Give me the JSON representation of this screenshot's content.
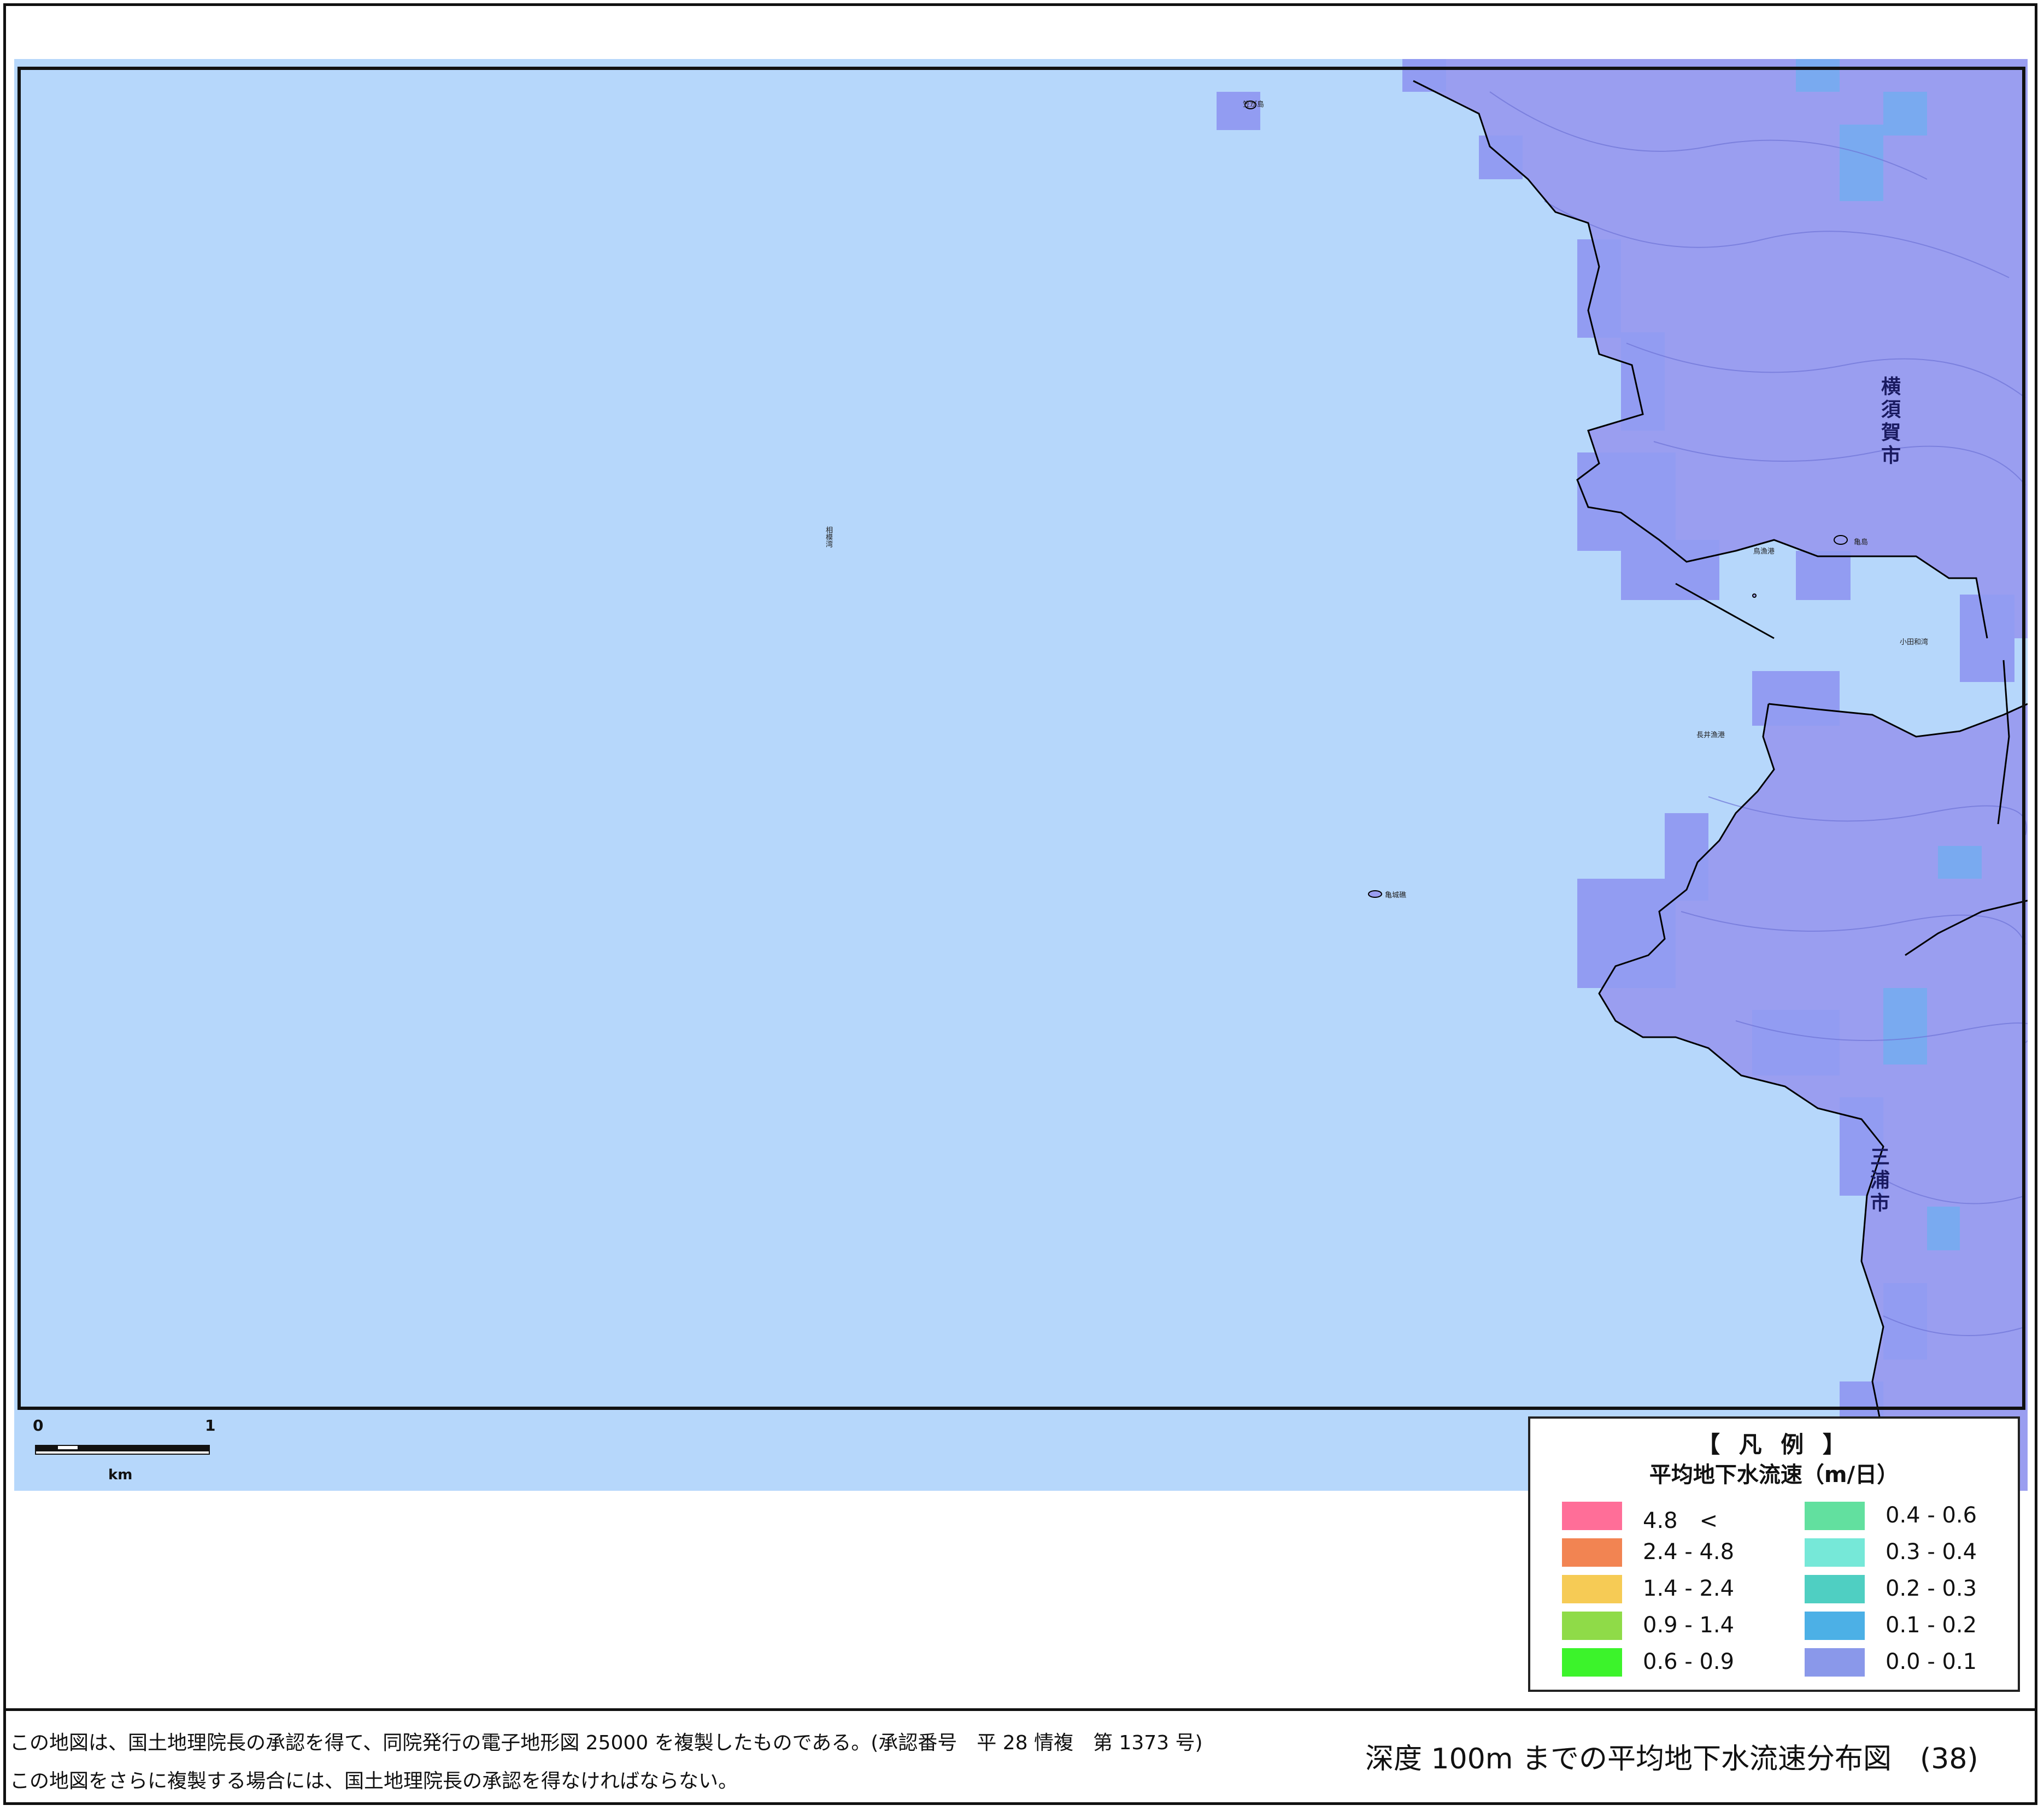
{
  "map": {
    "sea_color": "#b6d7fb",
    "land_color": "#9a9ef0",
    "grid_color": "#8c94ee",
    "water_cell_color": "#79aaf0",
    "coastline_color": "#000000",
    "labels": {
      "island_top": "笠が島",
      "bay": "相模湾",
      "port_1": "鳥漁港",
      "islet": "亀島",
      "bay_east": "小田和湾",
      "port_2": "長井漁港",
      "islet_2": "亀城礁",
      "city_1": "横須賀市",
      "city_2": "三浦市"
    }
  },
  "scale_bar": {
    "start": "0",
    "end": "1",
    "unit": "km"
  },
  "legend": {
    "title": "【 凡 例 】",
    "subtitle": "平均地下水流速（m/日）",
    "items": [
      {
        "label": "4.8　<",
        "color": "#ff6e98"
      },
      {
        "label": "2.4 - 4.8",
        "color": "#f28452"
      },
      {
        "label": "1.4 - 2.4",
        "color": "#f6cb55"
      },
      {
        "label": "0.9 - 1.4",
        "color": "#8fdb48"
      },
      {
        "label": "0.6 - 0.9",
        "color": "#3cf32b"
      },
      {
        "label": "0.4 - 0.6",
        "color": "#62e09f"
      },
      {
        "label": "0.3 - 0.4",
        "color": "#76e8d8"
      },
      {
        "label": "0.2 - 0.3",
        "color": "#4fcfc2"
      },
      {
        "label": "0.1 - 0.2",
        "color": "#4cb0e6"
      },
      {
        "label": "0.0 - 0.1",
        "color": "#8a98ea"
      }
    ]
  },
  "footer": {
    "note_1": "この地図は、国土地理院長の承認を得て、同院発行の電子地形図 25000 を複製したものである。(承認番号　平 28 情複　第 1373 号)",
    "note_2": "この地図をさらに複製する場合には、国土地理院長の承認を得なければならない。",
    "title": "深度 100m までの平均地下水流速分布図　(38)"
  }
}
